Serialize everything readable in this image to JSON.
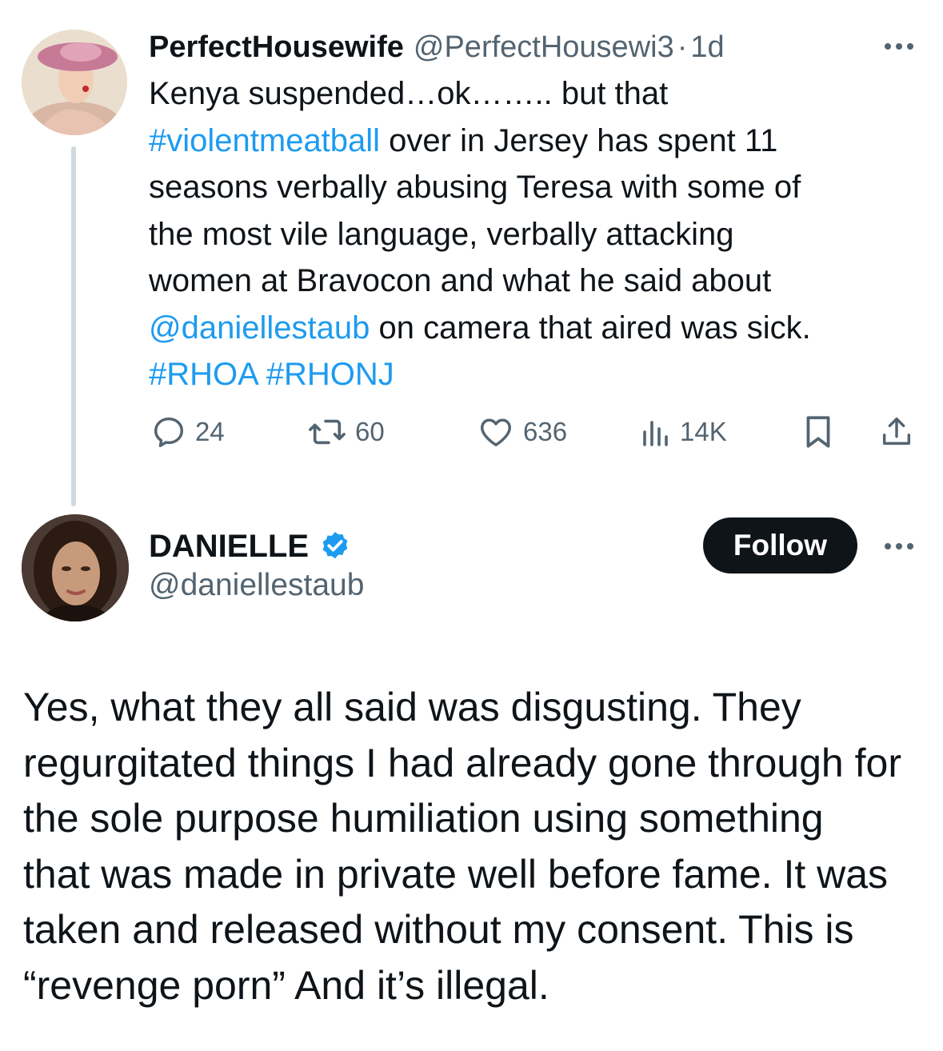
{
  "tweet1": {
    "display_name": "PerfectHousewife",
    "handle": "@PerfectHousewi3",
    "separator": "·",
    "time": "1d",
    "text_lines": [
      [
        {
          "t": "Kenya suspended…ok…….. but that",
          "link": false
        }
      ],
      [
        {
          "t": "#violentmeatball",
          "link": true
        },
        {
          "t": " over in Jersey has spent 11",
          "link": false
        }
      ],
      [
        {
          "t": "seasons  verbally abusing Teresa with some of",
          "link": false
        }
      ],
      [
        {
          "t": "the most vile language, verbally attacking",
          "link": false
        }
      ],
      [
        {
          "t": "women at Bravocon and what he said about",
          "link": false
        }
      ],
      [
        {
          "t": "@daniellestaub",
          "link": true
        },
        {
          "t": " on camera that aired was sick.",
          "link": false
        }
      ],
      [
        {
          "t": "#RHOA",
          "link": true
        },
        {
          "t": " ",
          "link": false
        },
        {
          "t": "#RHONJ",
          "link": true
        }
      ]
    ],
    "actions": {
      "replies": "24",
      "retweets": "60",
      "likes": "636",
      "views": "14K"
    },
    "icons": {
      "reply": "reply-icon",
      "retweet": "retweet-icon",
      "like": "heart-icon",
      "views": "views-icon",
      "bookmark": "bookmark-icon",
      "share": "share-icon",
      "more": "more-icon"
    }
  },
  "tweet2": {
    "display_name": "DANIELLE",
    "handle": "@daniellestaub",
    "follow_label": "Follow",
    "verified": true,
    "text_lines": [
      "Yes, what they all said was disgusting. They",
      "regurgitated things I had already gone through for",
      "the sole purpose humiliation using something",
      "that was made in private well before fame. It was",
      "taken and released without my consent. This is",
      "“revenge porn”   And it’s illegal."
    ]
  },
  "colors": {
    "text": "#0f1419",
    "secondary": "#536471",
    "link": "#1d9bf0",
    "verified": "#1d9bf0",
    "thread_line": "#cfd9de",
    "follow_bg": "#0f1419"
  }
}
